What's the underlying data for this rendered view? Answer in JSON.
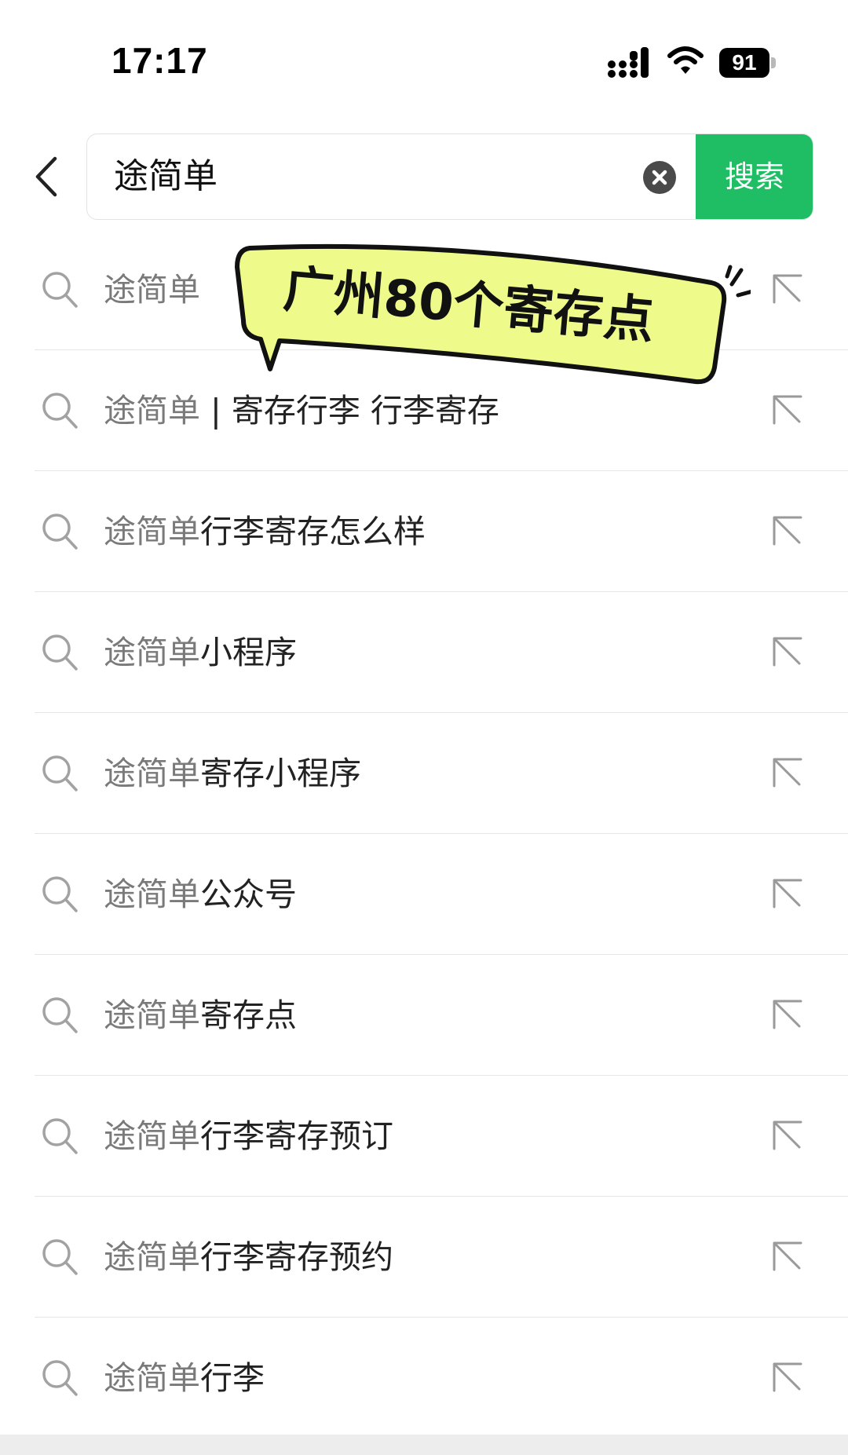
{
  "status_bar": {
    "time": "17:17",
    "battery": "91",
    "icons": [
      "cellular-signal-icon",
      "wifi-icon",
      "battery-icon"
    ]
  },
  "search": {
    "query": "途简单",
    "button_label": "搜索",
    "icons": [
      "back-arrow-icon",
      "clear-icon"
    ],
    "accent_color": "#1fbd64"
  },
  "sticker": {
    "text": "广州80个寄存点",
    "fill_color": "#eefb8a"
  },
  "suggestions": [
    {
      "query": "途简单",
      "rest": ""
    },
    {
      "query": "途简单",
      "rest": " | 寄存行李 行李寄存"
    },
    {
      "query": "途简单",
      "rest": "行李寄存怎么样"
    },
    {
      "query": "途简单",
      "rest": "小程序"
    },
    {
      "query": "途简单",
      "rest": "寄存小程序"
    },
    {
      "query": "途简单",
      "rest": "公众号"
    },
    {
      "query": "途简单",
      "rest": "寄存点"
    },
    {
      "query": "途简单",
      "rest": "行李寄存预订"
    },
    {
      "query": "途简单",
      "rest": "行李寄存预约"
    },
    {
      "query": "途简单",
      "rest": "行李"
    }
  ]
}
